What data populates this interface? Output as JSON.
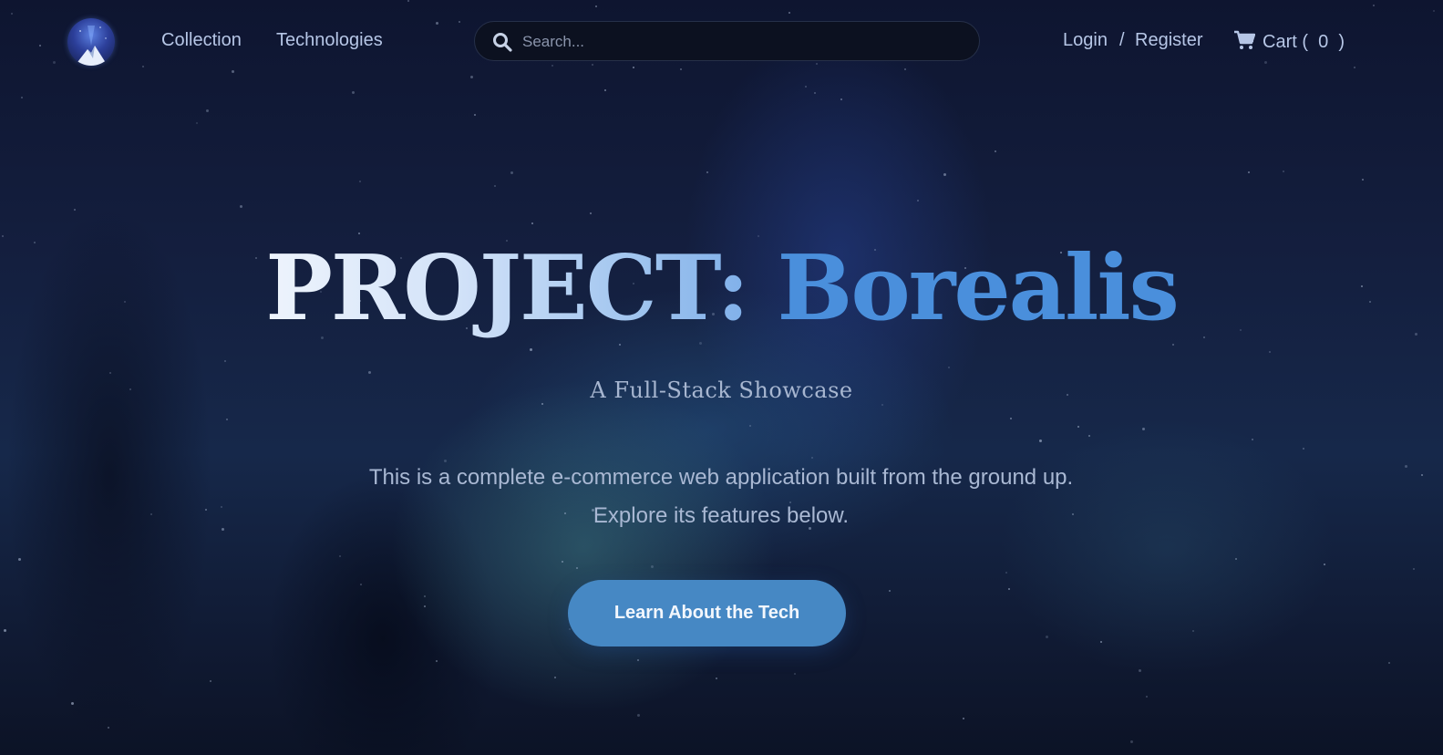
{
  "nav": {
    "logo": {
      "icon": "aurora-mountain-logo-icon"
    },
    "links": [
      {
        "label": "Collection"
      },
      {
        "label": "Technologies"
      }
    ],
    "search": {
      "placeholder": "Search...",
      "value": "",
      "icon": "search-icon"
    },
    "auth": {
      "login": "Login",
      "separator": "/",
      "register": "Register"
    },
    "cart": {
      "label": "Cart (",
      "count": "0",
      "close": ")",
      "icon": "cart-icon"
    }
  },
  "hero": {
    "title_part1": "PROJECT:",
    "title_part2": "Borealis",
    "subtitle": "A Full-Stack Showcase",
    "description": "This is a complete e-commerce web application built from the ground up. Explore its features below.",
    "cta_label": "Learn About the Tech"
  },
  "colors": {
    "background": "#141f3f",
    "accent": "#4a8fdc",
    "button": "#4688c4",
    "nav_text": "#b6c6e6"
  }
}
